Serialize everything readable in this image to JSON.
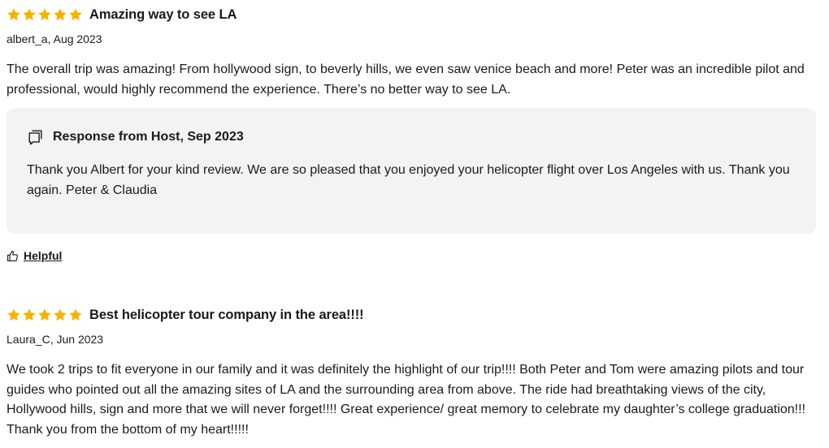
{
  "colors": {
    "star": "#f5b301",
    "response_bg": "#f3f3f3",
    "text": "#1a1a1a"
  },
  "reviews": [
    {
      "rating": 5,
      "title": "Amazing way to see LA",
      "meta": "albert_a, Aug 2023",
      "body": "The overall trip was amazing! From hollywood sign, to beverly hills, we even saw venice beach and more! Peter was an incredible pilot and professional, would highly recommend the experience. There’s no better way to see LA.",
      "response": {
        "icon": "chat-bubble-icon",
        "title": "Response from Host, Sep 2023",
        "text": "Thank you Albert for your kind review. We are so pleased that you enjoyed your helicopter flight over Los Angeles with us. Thank you again. Peter & Claudia"
      },
      "helpful": {
        "icon": "thumbs-up-icon",
        "label": "Helpful"
      }
    },
    {
      "rating": 5,
      "title": "Best helicopter tour company in the area!!!!",
      "meta": "Laura_C, Jun 2023",
      "body": "We took 2 trips to fit everyone in our family and it was definitely the highlight of our trip!!!! Both Peter and Tom were amazing pilots and tour guides who pointed out all the amazing sites of LA and the surrounding area from above. The ride had breathtaking views of the city, Hollywood hills, sign and more that we will never forget!!!! Great experience/ great memory to celebrate my daughter’s college graduation!!! Thank you from the bottom of my heart!!!!!"
    }
  ]
}
